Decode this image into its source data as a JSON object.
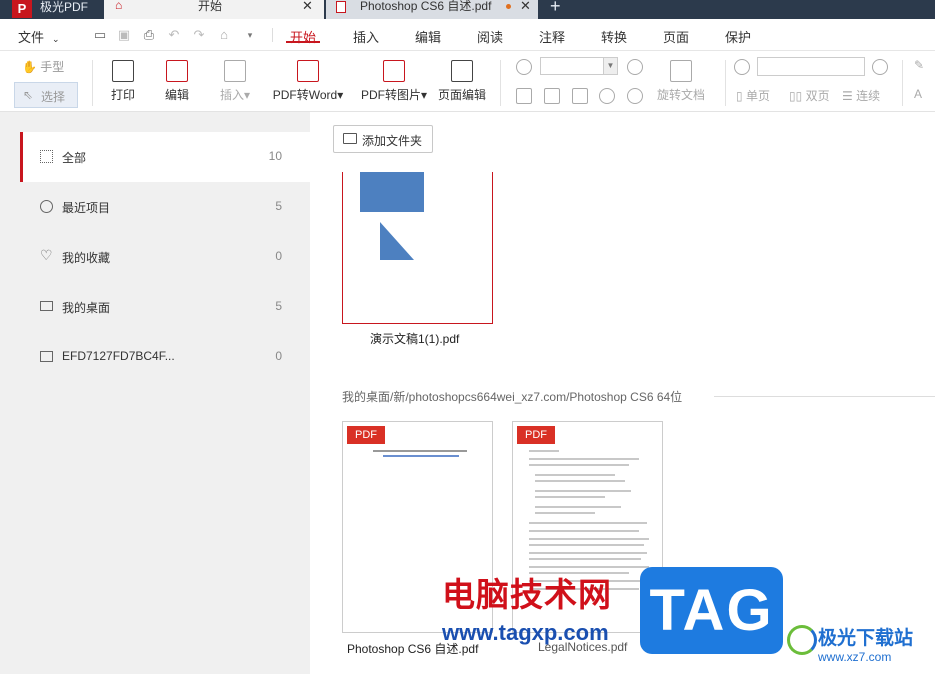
{
  "titlebar": {
    "app_name": "极光PDF",
    "tab_home": "开始",
    "tab_doc": "Photoshop CS6 自述.pdf",
    "new_tab": "+"
  },
  "menu": {
    "file": "文件",
    "items": [
      "开始",
      "插入",
      "编辑",
      "阅读",
      "注释",
      "转换",
      "页面",
      "保护"
    ],
    "active": "开始"
  },
  "ribbon": {
    "hand": "手型",
    "select": "选择",
    "print": "打印",
    "edit": "编辑",
    "insert": "插入",
    "pdf_to_word": "PDF转Word",
    "pdf_to_image": "PDF转图片",
    "page_edit": "页面编辑",
    "rotate_doc": "旋转文档",
    "single_page": "单页",
    "double_page": "双页",
    "continuous": "连续"
  },
  "sidebar": {
    "items": [
      {
        "label": "全部",
        "count": "10",
        "icon": "grid-icon"
      },
      {
        "label": "最近项目",
        "count": "5",
        "icon": "clock-icon"
      },
      {
        "label": "我的收藏",
        "count": "0",
        "icon": "heart-icon"
      },
      {
        "label": "我的桌面",
        "count": "5",
        "icon": "monitor-icon"
      },
      {
        "label": "EFD7127FD7BC4F...",
        "count": "0",
        "icon": "folder-icon"
      }
    ]
  },
  "main": {
    "add_folder": "添加文件夹",
    "files_top": [
      {
        "name": "演示文稿1(1).pdf"
      }
    ],
    "path": "我的桌面/新/photoshopcs664wei_xz7.com/Photoshop CS6 64位",
    "files": [
      {
        "name": "Photoshop CS6 自述.pdf",
        "badge": "PDF"
      },
      {
        "name": "LegalNotices.pdf",
        "badge": "PDF"
      }
    ]
  },
  "watermark": {
    "site_cn": "电脑技术网",
    "site_url": "www.tagxp.com",
    "tag": "TAG",
    "brand": "极光下载站",
    "brand_url": "www.xz7.com"
  },
  "colors": {
    "accent": "#c8161e",
    "titlebar": "#2c3a4c",
    "shape_blue": "#4d80c0"
  }
}
